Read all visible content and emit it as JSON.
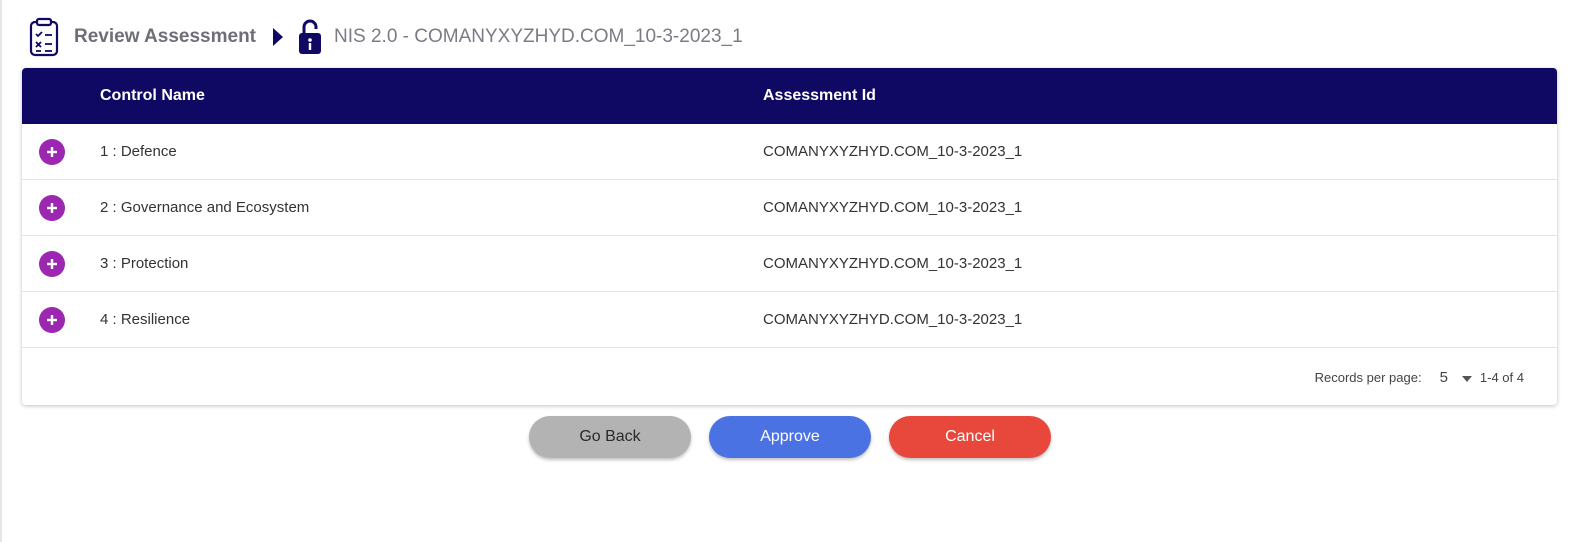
{
  "breadcrumb": {
    "icon": "checklist-clipboard-icon",
    "title": "Review Assessment",
    "separator_icon": "caret-right-icon",
    "status_icon": "lock-icon",
    "current": "NIS 2.0 - COMANYXYZHYD.COM_10-3-2023_1"
  },
  "table": {
    "columns": [
      "Control Name",
      "Assessment Id"
    ],
    "rows": [
      {
        "control_name": "1 : Defence",
        "assessment_id": "COMANYXYZHYD.COM_10-3-2023_1"
      },
      {
        "control_name": "2 : Governance and Ecosystem",
        "assessment_id": "COMANYXYZHYD.COM_10-3-2023_1"
      },
      {
        "control_name": "3 : Protection",
        "assessment_id": "COMANYXYZHYD.COM_10-3-2023_1"
      },
      {
        "control_name": "4 : Resilience",
        "assessment_id": "COMANYXYZHYD.COM_10-3-2023_1"
      }
    ],
    "header_color": "#0f0964",
    "expand_icon": "plus-circle-icon",
    "expand_color": "#9c27b0"
  },
  "pagination": {
    "label": "Records per page:",
    "per_page": "5",
    "range": "1-4 of 4"
  },
  "actions": {
    "go_back": "Go Back",
    "approve": "Approve",
    "cancel": "Cancel",
    "go_back_color": "#b3b3b3",
    "approve_color": "#4a72e2",
    "cancel_color": "#e8483b"
  }
}
